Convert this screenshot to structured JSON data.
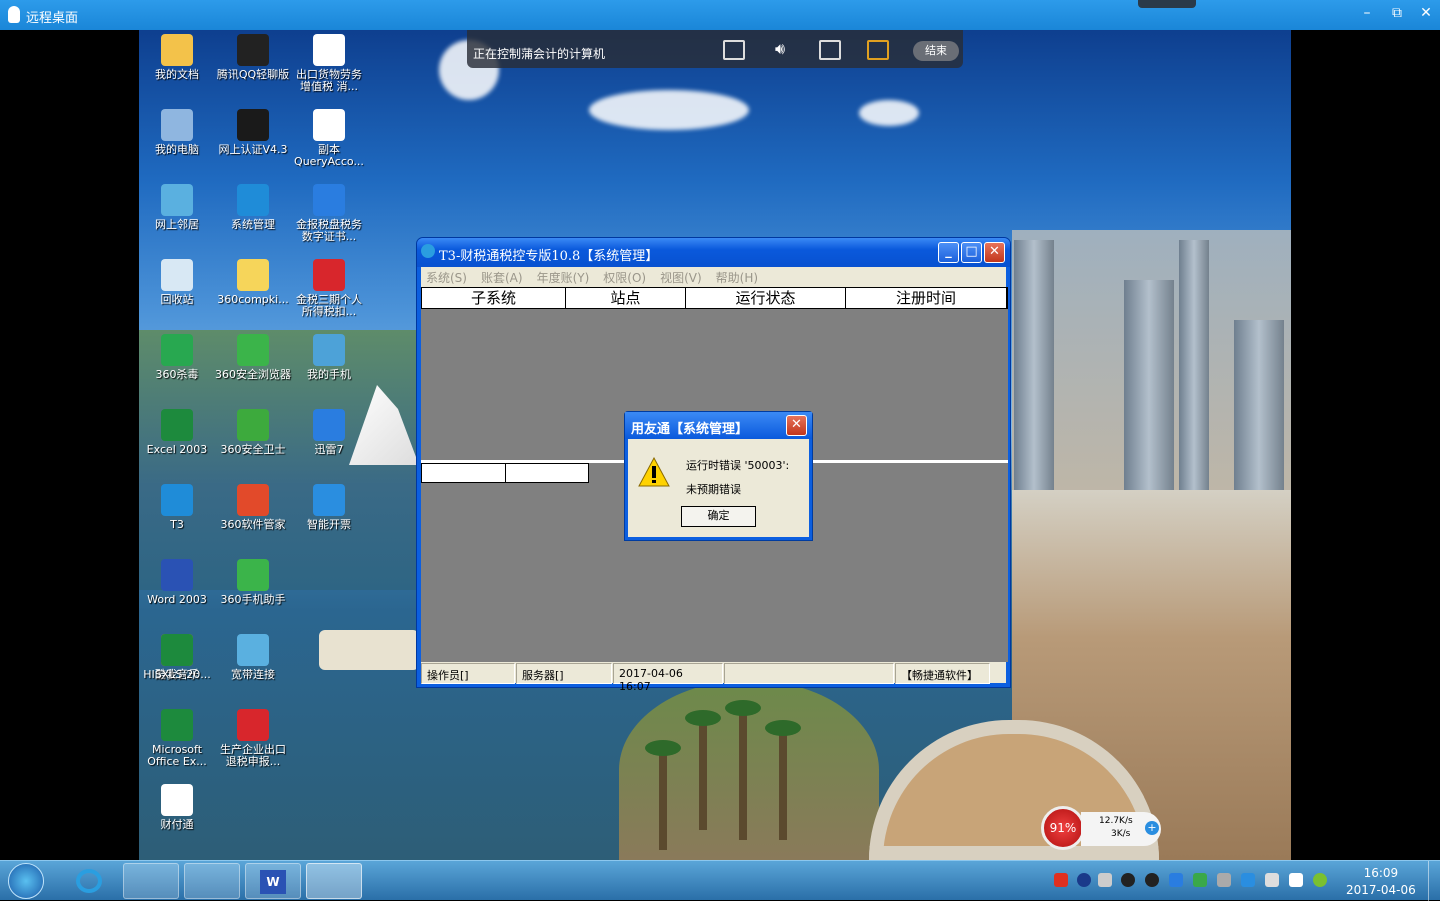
{
  "qq_bar": {
    "title": "远程桌面",
    "minimize": "–",
    "restore": "⧉",
    "close": "✕"
  },
  "remote_toolbar": {
    "label": "正在控制蒲会计的计算机",
    "end_label": "结束"
  },
  "desktop_icons": [
    {
      "label": "我的文档",
      "color": "#f3c24a"
    },
    {
      "label": "腾讯QQ轻聊版",
      "color": "#222222"
    },
    {
      "label": "出口货物劳务增值税 消...",
      "color": "#ffffff"
    },
    {
      "label": "我的电脑",
      "color": "#8fb6e0"
    },
    {
      "label": "网上认证V4.3",
      "color": "#1a1a1a"
    },
    {
      "label": "副本 QueryAcco...",
      "color": "#ffffff"
    },
    {
      "label": "网上邻居",
      "color": "#5ab0e0"
    },
    {
      "label": "系统管理",
      "color": "#1f8cd8"
    },
    {
      "label": "金报税盘税务数字证书...",
      "color": "#2a7de0"
    },
    {
      "label": "回收站",
      "color": "#d8e8f4"
    },
    {
      "label": "360compki...",
      "color": "#f6d55a"
    },
    {
      "label": "金税三期个人所得税扣...",
      "color": "#d8262c"
    },
    {
      "label": "360杀毒",
      "color": "#28a850"
    },
    {
      "label": "360安全浏览器",
      "color": "#3bb44a"
    },
    {
      "label": "我的手机",
      "color": "#4da2d8"
    },
    {
      "label": "Excel 2003",
      "color": "#1d8a3d"
    },
    {
      "label": "360安全卫士",
      "color": "#3daa3d"
    },
    {
      "label": "迅雷7",
      "color": "#2a7de0"
    },
    {
      "label": "T3",
      "color": "#1f8cd8"
    },
    {
      "label": "360软件管家",
      "color": "#e24a2a"
    },
    {
      "label": "智能开票",
      "color": "#2a8ee0"
    },
    {
      "label": "Word 2003",
      "color": "#2a52b4"
    },
    {
      "label": "360手机助手",
      "color": "#3bb44a"
    },
    {
      "label": "酷我音乐",
      "color": "#f28a1a"
    },
    {
      "label": "HISXLS-20...",
      "color": "#1d8a3d"
    },
    {
      "label": "宽带连接",
      "color": "#5ab0e0"
    },
    {
      "label": "Microsoft Office Ex...",
      "color": "#1d8a3d"
    },
    {
      "label": "生产企业出口退税申报...",
      "color": "#d8262c"
    },
    {
      "label": "财付通",
      "color": "#ffffff"
    }
  ],
  "t3_window": {
    "title": "T3-财税通税控专版10.8【系统管理】",
    "menu": [
      "系统(S)",
      "账套(A)",
      "年度账(Y)",
      "权限(O)",
      "视图(V)",
      "帮助(H)"
    ],
    "columns": [
      "子系统",
      "站点",
      "运行状态",
      "注册时间"
    ],
    "status": {
      "operator": "操作员[]",
      "server": "服务器[]",
      "datetime": "2017-04-06 16:07",
      "vendor": "【畅捷通软件】"
    }
  },
  "error_dialog": {
    "title": "用友通【系统管理】",
    "line1": "运行时错误 '50003':",
    "line2": "未预期错误",
    "ok": "确定"
  },
  "net_monitor": {
    "percent": "91%",
    "up": "12.7K/s",
    "down": "3K/s"
  },
  "clock": {
    "time": "16:09",
    "date": "2017-04-06"
  },
  "colors": {
    "taskbar": "#2a6fa8",
    "xp_title": "#0a59dc",
    "qq_bar": "#1a86d8"
  }
}
